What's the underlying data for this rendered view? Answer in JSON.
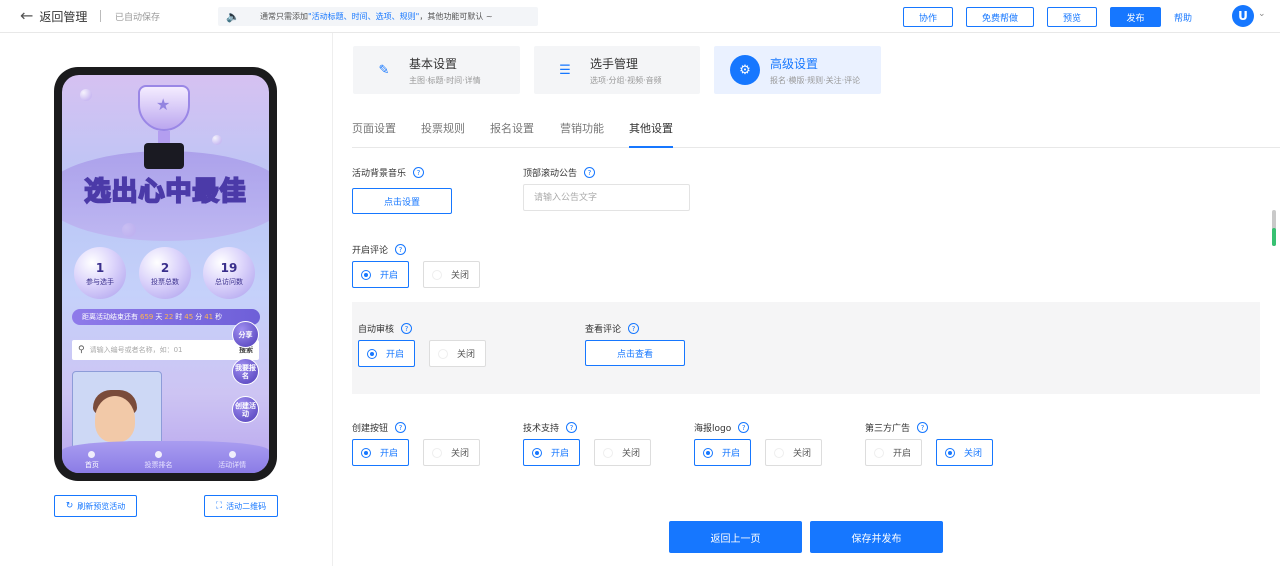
{
  "topbar": {
    "back_label": "返回管理",
    "autosave": "已自动保存",
    "tip_prefix": "通常只需添加",
    "tip_highlight": "\"活动标题、时间、选项、规则\"",
    "tip_suffix": "，其他功能可默认 ~",
    "buttons": {
      "collab": "协作",
      "free_help": "免费帮做",
      "preview": "预览",
      "publish": "发布"
    },
    "help": "帮助",
    "avatar_letter": "U"
  },
  "preview": {
    "title": "选出心中最佳",
    "stats": [
      {
        "value": "1",
        "label": "参与选手"
      },
      {
        "value": "2",
        "label": "投票总数"
      },
      {
        "value": "19",
        "label": "总访问数"
      }
    ],
    "countdown": {
      "prefix": "距离活动结束还有",
      "days": "659",
      "days_unit": "天",
      "hours": "22",
      "hours_unit": "时",
      "minutes": "45",
      "minutes_unit": "分",
      "seconds": "41",
      "seconds_unit": "秒"
    },
    "search_placeholder": "请输入编号或者名称，如：01",
    "search_button": "搜索",
    "float_share": "分享",
    "float_signup": "我要报名",
    "float_create": "创建活动",
    "nav": [
      "首页",
      "投票排名",
      "活动详情"
    ],
    "refresh_button": "刷新预览活动",
    "qrcode_button": "活动二维码"
  },
  "steps": [
    {
      "title": "基本设置",
      "sub": "主图·标题·时间·详情",
      "icon": "edit-icon"
    },
    {
      "title": "选手管理",
      "sub": "选项·分组·视频·音频",
      "icon": "list-icon"
    },
    {
      "title": "高级设置",
      "sub": "报名·模版·规则·关注·评论",
      "icon": "gear-icon"
    }
  ],
  "subtabs": [
    "页面设置",
    "投票规则",
    "报名设置",
    "营销功能",
    "其他设置"
  ],
  "settings": {
    "bg_music": {
      "label": "活动背景音乐",
      "button": "点击设置"
    },
    "top_notice": {
      "label": "顶部滚动公告",
      "placeholder": "请输入公告文字"
    },
    "enable_comment": {
      "label": "开启评论",
      "on": "开启",
      "off": "关闭"
    },
    "auto_review": {
      "label": "自动审核",
      "on": "开启",
      "off": "关闭"
    },
    "view_comment": {
      "label": "查看评论",
      "button": "点击查看"
    },
    "create_button": {
      "label": "创建按钮",
      "on": "开启",
      "off": "关闭"
    },
    "tech_support": {
      "label": "技术支持",
      "on": "开启",
      "off": "关闭"
    },
    "poster_logo": {
      "label": "海报logo",
      "on": "开启",
      "off": "关闭"
    },
    "third_party_ads": {
      "label": "第三方广告",
      "on": "开启",
      "off": "关闭"
    }
  },
  "footer": {
    "prev": "返回上一页",
    "save": "保存并发布"
  },
  "colors": {
    "primary": "#1677ff",
    "text": "#333333"
  }
}
